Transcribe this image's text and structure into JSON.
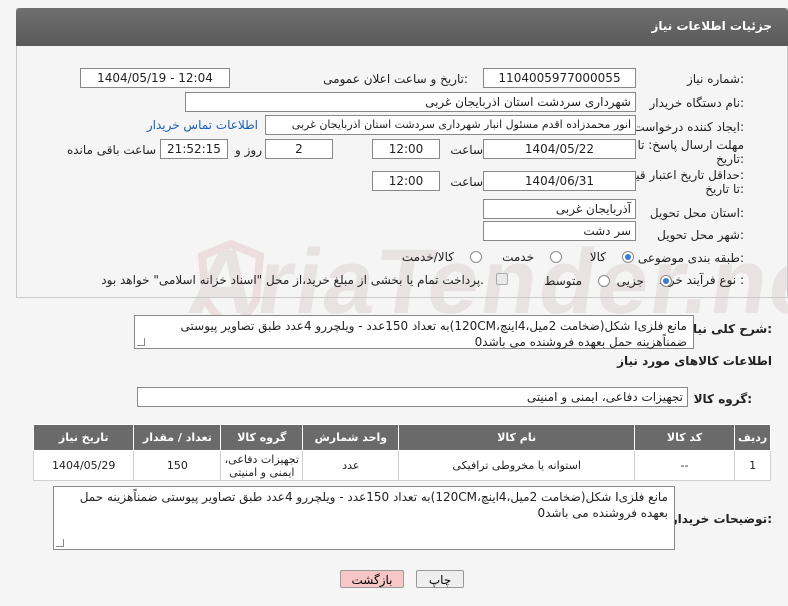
{
  "header": {
    "title": "جزئیات اطلاعات نیاز"
  },
  "fields": {
    "need_number_label": "شماره نیاز:",
    "need_number": "1104005977000055",
    "announce_label": "تاریخ و ساعت اعلان عمومی:",
    "announce_value": "1404/05/19 - 12:04",
    "buyer_org_label": "نام دستگاه خریدار:",
    "buyer_org": "شهرداری سردشت استان اذربایجان غربی",
    "requester_label": "ایجاد کننده درخواست:",
    "requester": "انور محمدزاده اقدم مسئول انبار شهرداری سردشت استان اذربایجان غربی",
    "contact_link": "اطلاعات تماس خریدار",
    "deadline_label_1": "مهلت ارسال پاسخ: تا",
    "deadline_label_2": "تاریخ:",
    "deadline_date": "1404/05/22",
    "time_label": "ساعت",
    "deadline_time": "12:00",
    "days_value": "2",
    "days_label": "روز و",
    "remaining_time": "21:52:15",
    "remaining_label": "ساعت باقی مانده",
    "validity_label_1": "حداقل تاریخ اعتبار قیمت:",
    "validity_label_2": "تا تاریخ:",
    "validity_date": "1404/06/31",
    "validity_time": "12:00",
    "province_label": "استان محل تحویل:",
    "province": "آذربایجان غربی",
    "city_label": "شهر محل تحویل:",
    "city": "سر دشت",
    "category_label": "طبقه بندی موضوعی:",
    "category_options": [
      "کالا",
      "خدمت",
      "کالا/خدمت"
    ],
    "process_label": "نوع فرآیند خرید :",
    "process_options": [
      "جزیی",
      "متوسط"
    ],
    "payment_note": "پرداخت تمام یا بخشی از مبلغ خرید،از محل \"اسناد خزانه اسلامی\" خواهد بود."
  },
  "general_desc_label": "شرح کلی نیاز:",
  "general_desc": "مانع فلزیI شکل(ضخامت 2میل،4اینچ،120CM)به تعداد 150عدد - ویلچررو 4عدد طبق تصاویر پیوستی ضمناًهزینه حمل بعهده فروشنده می باشد0",
  "goods_info_title": "اطلاعات کالاهای مورد نیاز",
  "goods_group_label": "گروه کالا:",
  "goods_group": "تجهیزات دفاعی، ایمنی و امنیتی",
  "table": {
    "headers": [
      "ردیف",
      "کد کالا",
      "نام کالا",
      "واحد شمارش",
      "گروه کالا",
      "تعداد / مقدار",
      "تاریخ نیاز"
    ],
    "rows": [
      [
        "1",
        "--",
        "استوانه یا مخروطی ترافیکی",
        "عدد",
        "تجهیزات دفاعی، ایمنی و امنیتی",
        "150",
        "1404/05/29"
      ]
    ]
  },
  "buyer_notes_label": "توضیحات خریدار:",
  "buyer_notes": "مانع فلزیI شکل(ضخامت 2میل،4اینچ،120CM)به تعداد 150عدد - ویلچررو 4عدد طبق تصاویر پیوستی ضمناًهزینه حمل بعهده فروشنده می باشد0",
  "buttons": {
    "print": "چاپ",
    "back": "بازگشت"
  },
  "watermark": "AriaTender.net",
  "colors": {
    "header": "#5f5f5f",
    "back_button": "#f7c6c6",
    "print_button": "#eeeeee",
    "link": "#1a5fb4"
  }
}
